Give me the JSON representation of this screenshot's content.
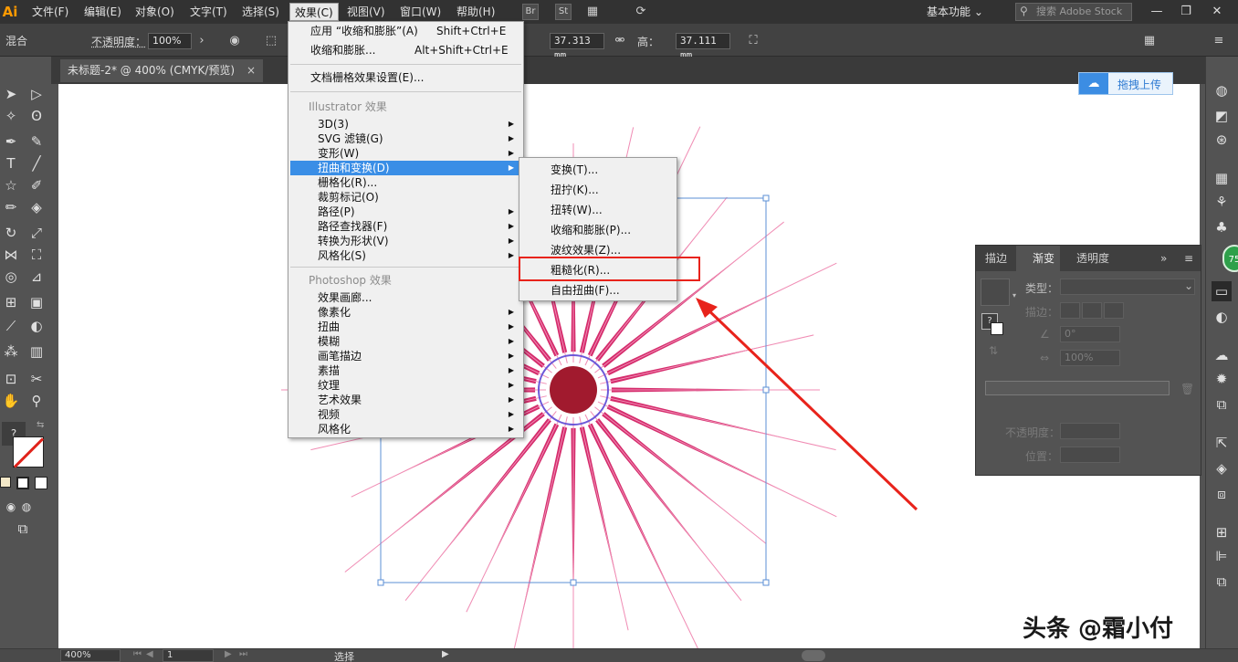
{
  "app": {
    "logo": "Ai"
  },
  "menubar": {
    "items": [
      "文件(F)",
      "编辑(E)",
      "对象(O)",
      "文字(T)",
      "选择(S)",
      "效果(C)",
      "视图(V)",
      "窗口(W)",
      "帮助(H)"
    ],
    "active": "效果(C)",
    "icons": [
      "Br",
      "St"
    ],
    "workspace": "基本功能",
    "search_placeholder": "搜索 Adobe Stock"
  },
  "control_bar": {
    "mode": "混合",
    "opacity_label": "不透明度：",
    "opacity_value": "100%",
    "width_value": "37.313 mm",
    "height_label": "高：",
    "height_value": "37.111 mm"
  },
  "document_tab": {
    "title": "未标题-2* @ 400% (CMYK/预览)",
    "close": "×"
  },
  "effect_menu": {
    "apply_last": "应用 “收缩和膨胀”(A)",
    "apply_last_shortcut": "Shift+Ctrl+E",
    "last_effect": "收缩和膨胀...",
    "last_effect_shortcut": "Alt+Shift+Ctrl+E",
    "raster_settings": "文档栅格效果设置(E)...",
    "illustrator_header": "Illustrator 效果",
    "illustrator_items": [
      "3D(3)",
      "SVG 滤镜(G)",
      "变形(W)",
      "扭曲和变换(D)",
      "栅格化(R)...",
      "裁剪标记(O)",
      "路径(P)",
      "路径查找器(F)",
      "转换为形状(V)",
      "风格化(S)"
    ],
    "photoshop_header": "Photoshop 效果",
    "photoshop_items": [
      "效果画廊...",
      "像素化",
      "扭曲",
      "模糊",
      "画笔描边",
      "素描",
      "纹理",
      "艺术效果",
      "视频",
      "风格化"
    ]
  },
  "distort_submenu": {
    "items": [
      "变换(T)...",
      "扭拧(K)...",
      "扭转(W)...",
      "收缩和膨胀(P)...",
      "波纹效果(Z)...",
      "粗糙化(R)...",
      "自由扭曲(F)..."
    ],
    "highlighted": "粗糙化(R)..."
  },
  "upload_button": {
    "label": "拖拽上传"
  },
  "gradient_panel": {
    "tabs": [
      "描边",
      "渐变",
      "透明度"
    ],
    "active_tab": "渐变",
    "type_label": "类型：",
    "stroke_label": "描边：",
    "angle_value": "0°",
    "aspect_value": "100%",
    "opacity_label": "不透明度：",
    "position_label": "位置："
  },
  "side_badge": {
    "value": "75"
  },
  "statusbar": {
    "zoom": "400%",
    "page": "1",
    "status": "选择"
  },
  "watermark": {
    "text": "头条 @霜小付"
  },
  "colors": {
    "accent": "#3a8ee6",
    "starburst": "#d0155c",
    "center": "#a11a2e",
    "annotation": "#e8231b"
  }
}
